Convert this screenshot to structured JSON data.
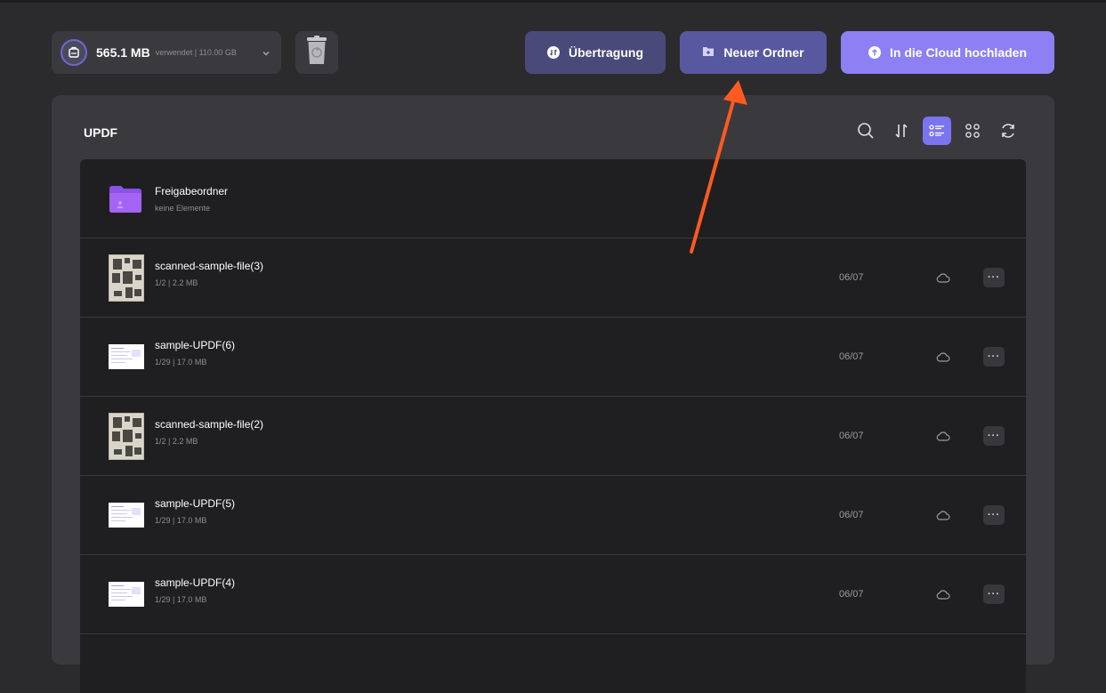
{
  "storage": {
    "used": "565.1 MB",
    "total": "verwendet | 110.00 GB",
    "icon": "storage-icon"
  },
  "toolbar": {
    "transfer_label": "Übertragung",
    "new_folder_label": "Neuer Ordner",
    "upload_label": "In die Cloud hochladen"
  },
  "panel": {
    "title": "UPDF",
    "tools": [
      "search-icon",
      "sort-icon",
      "list-view-icon",
      "grid-view-icon",
      "refresh-icon"
    ],
    "active_tool": "list-view-icon"
  },
  "colors": {
    "accent": "#7b74f0",
    "annotation_arrow": "#ff5a1f"
  },
  "items": [
    {
      "type": "folder",
      "name": "Freigabeordner",
      "meta": "keine Elemente"
    },
    {
      "type": "scan",
      "name": "scanned-sample-file(3)",
      "meta": "1/2 | 2.2 MB",
      "date": "06/07"
    },
    {
      "type": "doc",
      "name": "sample-UPDF(6)",
      "meta": "1/29 | 17.0 MB",
      "date": "06/07"
    },
    {
      "type": "scan",
      "name": "scanned-sample-file(2)",
      "meta": "1/2 | 2.2 MB",
      "date": "06/07"
    },
    {
      "type": "doc",
      "name": "sample-UPDF(5)",
      "meta": "1/29 | 17.0 MB",
      "date": "06/07"
    },
    {
      "type": "doc",
      "name": "sample-UPDF(4)",
      "meta": "1/29 | 17.0 MB",
      "date": "06/07"
    }
  ]
}
